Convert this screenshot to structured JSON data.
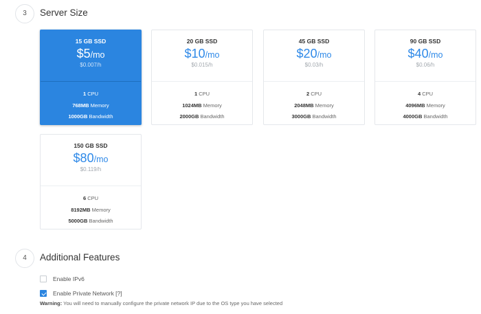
{
  "server_size": {
    "step": "3",
    "title": "Server Size",
    "plans": [
      {
        "name": "15 GB SSD",
        "price": "$5",
        "period": "/mo",
        "hourly": "$0.007/h",
        "cpu": "1",
        "cpu_label": "CPU",
        "memory": "768MB",
        "memory_label": "Memory",
        "bandwidth": "1000GB",
        "bandwidth_label": "Bandwidth",
        "selected": true
      },
      {
        "name": "20 GB SSD",
        "price": "$10",
        "period": "/mo",
        "hourly": "$0.015/h",
        "cpu": "1",
        "cpu_label": "CPU",
        "memory": "1024MB",
        "memory_label": "Memory",
        "bandwidth": "2000GB",
        "bandwidth_label": "Bandwidth",
        "selected": false
      },
      {
        "name": "45 GB SSD",
        "price": "$20",
        "period": "/mo",
        "hourly": "$0.03/h",
        "cpu": "2",
        "cpu_label": "CPU",
        "memory": "2048MB",
        "memory_label": "Memory",
        "bandwidth": "3000GB",
        "bandwidth_label": "Bandwidth",
        "selected": false
      },
      {
        "name": "90 GB SSD",
        "price": "$40",
        "period": "/mo",
        "hourly": "$0.06/h",
        "cpu": "4",
        "cpu_label": "CPU",
        "memory": "4096MB",
        "memory_label": "Memory",
        "bandwidth": "4000GB",
        "bandwidth_label": "Bandwidth",
        "selected": false
      },
      {
        "name": "150 GB SSD",
        "price": "$80",
        "period": "/mo",
        "hourly": "$0.119/h",
        "cpu": "6",
        "cpu_label": "CPU",
        "memory": "8192MB",
        "memory_label": "Memory",
        "bandwidth": "5000GB",
        "bandwidth_label": "Bandwidth",
        "selected": false
      }
    ]
  },
  "additional_features": {
    "step": "4",
    "title": "Additional Features",
    "options": [
      {
        "label": "Enable IPv6",
        "checked": false
      },
      {
        "label": "Enable Private Network [?]",
        "checked": true
      }
    ],
    "warning_label": "Warning:",
    "warning_text": " You will need to manually configure the private network IP due to the OS type you have selected"
  },
  "colors": {
    "accent": "#2b85e0",
    "price_text": "#2e89e8",
    "border": "#e4e7eb"
  }
}
